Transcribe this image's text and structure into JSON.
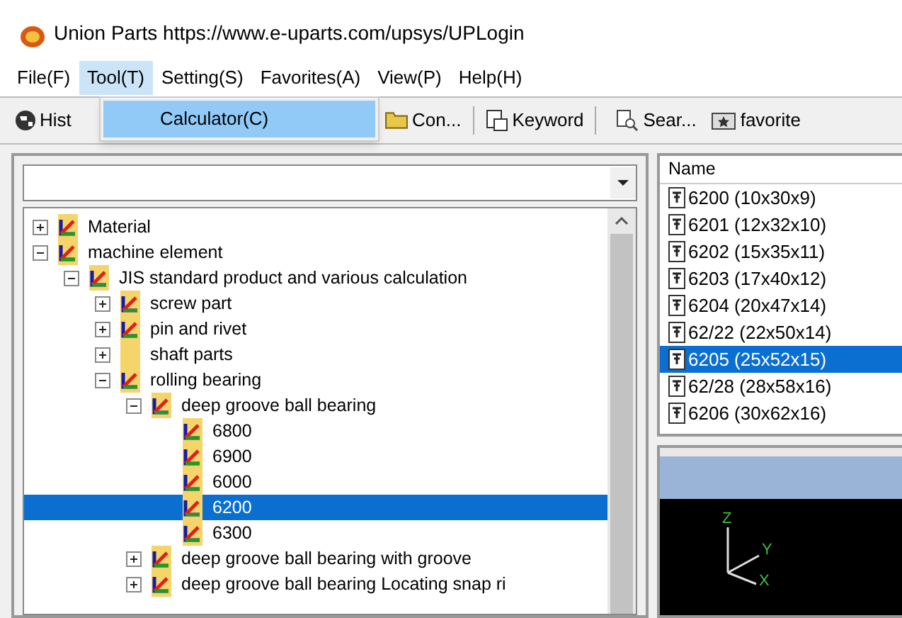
{
  "window": {
    "title": "Union Parts https://www.e-uparts.com/upsys/UPLogin"
  },
  "menu": [
    {
      "label": "File(F)",
      "selected": false
    },
    {
      "label": "Tool(T)",
      "selected": true
    },
    {
      "label": "Setting(S)",
      "selected": false
    },
    {
      "label": "Favorites(A)",
      "selected": false
    },
    {
      "label": "View(P)",
      "selected": false
    },
    {
      "label": "Help(H)",
      "selected": false
    }
  ],
  "dropdown": {
    "items": [
      {
        "label": "Calculator(C)",
        "selected": true
      }
    ]
  },
  "toolbar": [
    {
      "label": "Hist",
      "kind": "history"
    },
    {
      "label": "Con...",
      "kind": "folder"
    },
    {
      "label": "Keyword",
      "kind": "keyword"
    },
    {
      "label": "Sear...",
      "kind": "search"
    },
    {
      "label": "favorite",
      "kind": "favorite"
    }
  ],
  "tree": [
    {
      "label": "Material",
      "kind": "marked",
      "expanded": false,
      "selected": false
    },
    {
      "label": "machine element",
      "kind": "marked",
      "expanded": true,
      "selected": false,
      "children": [
        {
          "label": "JIS standard product and various calculation",
          "kind": "marked",
          "expanded": true,
          "selected": false,
          "children": [
            {
              "label": "screw part",
              "kind": "marked",
              "expanded": false,
              "selected": false
            },
            {
              "label": "pin and rivet",
              "kind": "marked",
              "expanded": false,
              "selected": false
            },
            {
              "label": "shaft parts",
              "kind": "plain",
              "expanded": false,
              "selected": false
            },
            {
              "label": "rolling bearing",
              "kind": "marked",
              "expanded": true,
              "selected": false,
              "children": [
                {
                  "label": "deep groove ball bearing",
                  "kind": "marked",
                  "expanded": true,
                  "selected": false,
                  "children": [
                    {
                      "label": "6800",
                      "kind": "marked",
                      "selected": false
                    },
                    {
                      "label": "6900",
                      "kind": "marked",
                      "selected": false
                    },
                    {
                      "label": "6000",
                      "kind": "marked",
                      "selected": false
                    },
                    {
                      "label": "6200",
                      "kind": "marked",
                      "selected": true
                    },
                    {
                      "label": "6300",
                      "kind": "marked",
                      "selected": false
                    }
                  ]
                },
                {
                  "label": "deep groove ball bearing with groove",
                  "kind": "marked",
                  "expanded": false,
                  "selected": false
                },
                {
                  "label": "deep groove ball bearing Locating snap ri",
                  "kind": "marked",
                  "expanded": false,
                  "selected": false
                }
              ]
            }
          ]
        }
      ]
    }
  ],
  "list": {
    "header": "Name",
    "rows": [
      {
        "label": "6200 (10x30x9)",
        "selected": false
      },
      {
        "label": "6201 (12x32x10)",
        "selected": false
      },
      {
        "label": "6202 (15x35x11)",
        "selected": false
      },
      {
        "label": "6203 (17x40x12)",
        "selected": false
      },
      {
        "label": "6204 (20x47x14)",
        "selected": false
      },
      {
        "label": "62/22 (22x50x14)",
        "selected": false
      },
      {
        "label": "6205 (25x52x15)",
        "selected": true
      },
      {
        "label": "62/28 (28x58x16)",
        "selected": false
      },
      {
        "label": "6206 (30x62x16)",
        "selected": false
      }
    ]
  },
  "viewer": {
    "axes": [
      "Z",
      "Y",
      "X"
    ]
  }
}
